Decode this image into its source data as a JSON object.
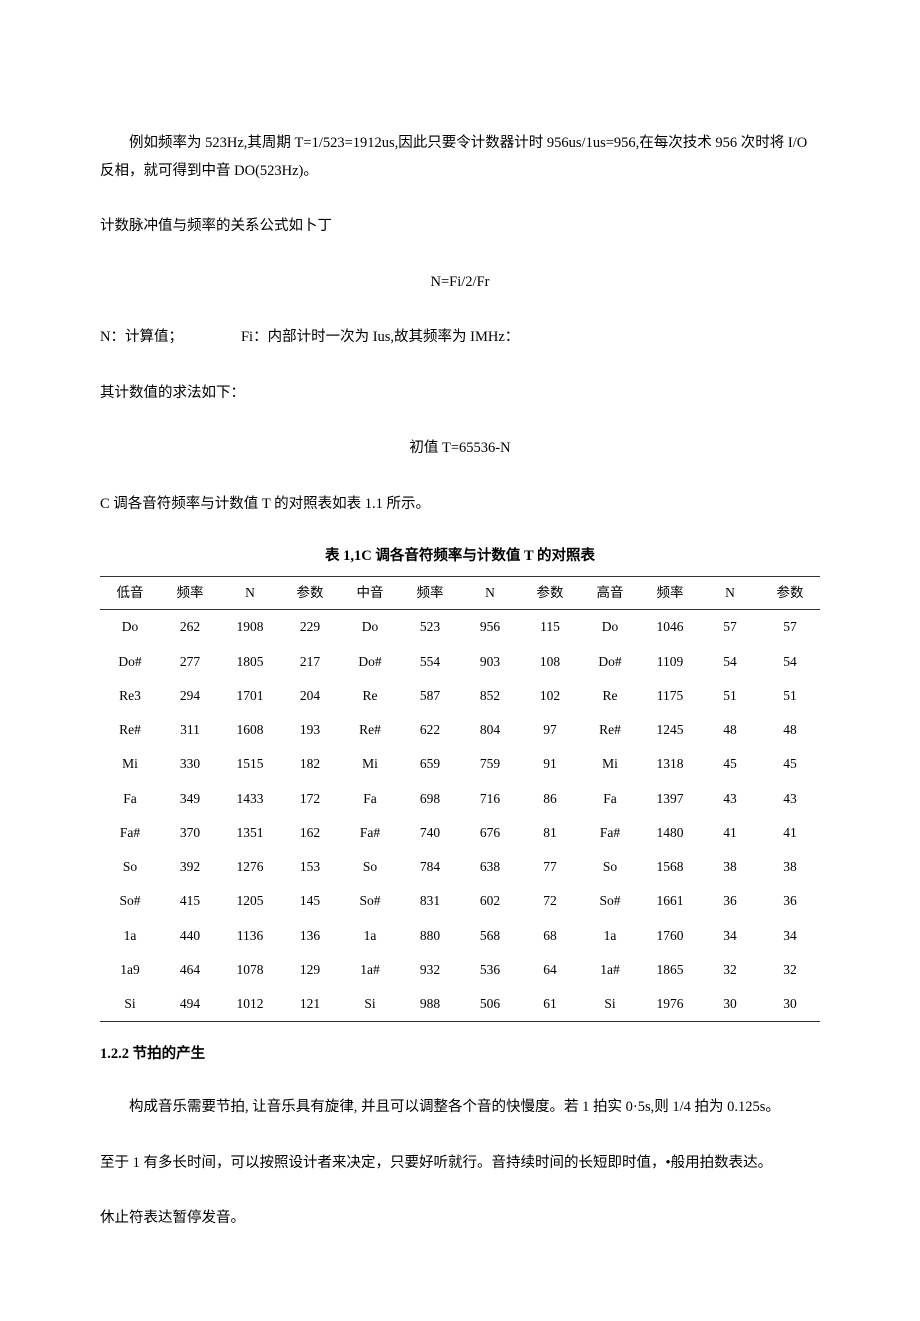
{
  "para1": "例如频率为 523Hz,其周期 T=1/523=1912us,因此只要令计数器计时 956us/1us=956,在每次技术 956 次时将 I/O反相，就可得到中音 DO(523Hz)。",
  "para2": "计数脉冲值与频率的关系公式如卜丁",
  "formula1": "N=Fi/2/Fr",
  "para3": "N：计算值；    Fi：内部计时一次为 Ius,故其频率为 IMHz：",
  "para4": "其计数值的求法如下：",
  "formula2": "初值 T=65536-N",
  "para5": "C 调各音符频率与计数值 T 的对照表如表 1.1 所示。",
  "table_caption": "表 1,1C 调各音符频率与计数值 T 的对照表",
  "headers": [
    "低音",
    "频率",
    "N",
    "参数",
    "中音",
    "频率",
    "N",
    "参数",
    "高音",
    "频率",
    "N",
    "参数"
  ],
  "rows": [
    [
      "Do",
      "262",
      "1908",
      "229",
      "Do",
      "523",
      "956",
      "115",
      "Do",
      "1046",
      "57",
      "57"
    ],
    [
      "Do#",
      "277",
      "1805",
      "217",
      "Do#",
      "554",
      "903",
      "108",
      "Do#",
      "1109",
      "54",
      "54"
    ],
    [
      "Re3",
      "294",
      "1701",
      "204",
      "Re",
      "587",
      "852",
      "102",
      "Re",
      "1175",
      "51",
      "51"
    ],
    [
      "Re#",
      "311",
      "1608",
      "193",
      "Re#",
      "622",
      "804",
      "97",
      "Re#",
      "1245",
      "48",
      "48"
    ],
    [
      "Mi",
      "330",
      "1515",
      "182",
      "Mi",
      "659",
      "759",
      "91",
      "Mi",
      "1318",
      "45",
      "45"
    ],
    [
      "Fa",
      "349",
      "1433",
      "172",
      "Fa",
      "698",
      "716",
      "86",
      "Fa",
      "1397",
      "43",
      "43"
    ],
    [
      "Fa#",
      "370",
      "1351",
      "162",
      "Fa#",
      "740",
      "676",
      "81",
      "Fa#",
      "1480",
      "41",
      "41"
    ],
    [
      "So",
      "392",
      "1276",
      "153",
      "So",
      "784",
      "638",
      "77",
      "So",
      "1568",
      "38",
      "38"
    ],
    [
      "So#",
      "415",
      "1205",
      "145",
      "So#",
      "831",
      "602",
      "72",
      "So#",
      "1661",
      "36",
      "36"
    ],
    [
      "1a",
      "440",
      "1136",
      "136",
      "1a",
      "880",
      "568",
      "68",
      "1a",
      "1760",
      "34",
      "34"
    ],
    [
      "1a9",
      "464",
      "1078",
      "129",
      "1a#",
      "932",
      "536",
      "64",
      "1a#",
      "1865",
      "32",
      "32"
    ],
    [
      "Si",
      "494",
      "1012",
      "121",
      "Si",
      "988",
      "506",
      "61",
      "Si",
      "1976",
      "30",
      "30"
    ]
  ],
  "section_h": "1.2.2 节拍的产生",
  "para6": "构成音乐需要节拍, 让音乐具有旋律, 并且可以调整各个音的快慢度。若 1 拍实 0·5s,则 1/4 拍为 0.125s。",
  "para7": "至于 1 有多长时间，可以按照设计者来决定，只要好听就行。音持续时间的长短即时值，•般用拍数表达。",
  "para8": "休止符表达暂停发音。"
}
